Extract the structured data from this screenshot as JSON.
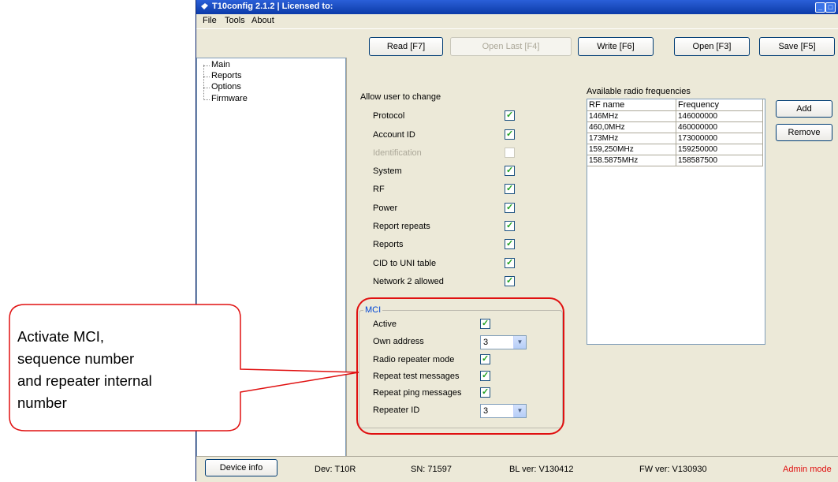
{
  "window": {
    "title": "T10config 2.1.2  |  Licensed to:"
  },
  "menu": {
    "file": "File",
    "tools": "Tools",
    "about": "About"
  },
  "toolbar": {
    "read": "Read [F7]",
    "open_last": "Open Last [F4]",
    "write": "Write [F6]",
    "open": "Open [F3]",
    "save": "Save [F5]"
  },
  "tree": {
    "items": [
      "Main",
      "Reports",
      "Options",
      "Firmware"
    ]
  },
  "allow": {
    "heading": "Allow user to change",
    "items": [
      {
        "label": "Protocol",
        "checked": true,
        "enabled": true
      },
      {
        "label": "Account ID",
        "checked": true,
        "enabled": true
      },
      {
        "label": "Identification",
        "checked": false,
        "enabled": false
      },
      {
        "label": "System",
        "checked": true,
        "enabled": true
      },
      {
        "label": "RF",
        "checked": true,
        "enabled": true
      },
      {
        "label": "Power",
        "checked": true,
        "enabled": true
      },
      {
        "label": "Report repeats",
        "checked": true,
        "enabled": true
      },
      {
        "label": "Reports",
        "checked": true,
        "enabled": true
      },
      {
        "label": "CID to UNI table",
        "checked": true,
        "enabled": true
      },
      {
        "label": "Network 2 allowed",
        "checked": true,
        "enabled": true
      }
    ]
  },
  "frequencies": {
    "heading": "Available radio frequencies",
    "columns": [
      "RF name",
      "Frequency"
    ],
    "rows": [
      [
        "146MHz",
        "146000000"
      ],
      [
        "460,0MHz",
        "460000000"
      ],
      [
        "173MHz",
        "173000000"
      ],
      [
        "159,250MHz",
        "159250000"
      ],
      [
        "158.5875MHz",
        "158587500"
      ]
    ],
    "add": "Add",
    "remove": "Remove"
  },
  "mci": {
    "title": "MCI",
    "active": "Active",
    "own_address": "Own address",
    "own_address_value": "3",
    "radio_repeater_mode": "Radio repeater mode",
    "repeat_test": "Repeat test messages",
    "repeat_ping": "Repeat ping messages",
    "repeater_id": "Repeater ID",
    "repeater_id_value": "3"
  },
  "status": {
    "device_info": "Device info",
    "dev": "Dev:  T10R",
    "sn": "SN:  71597",
    "bl": "BL ver:  V130412",
    "fw": "FW ver:  V130930",
    "mode": "Admin mode"
  },
  "callout": {
    "lines": [
      "Activate MCI,",
      "sequence number",
      "and repeater internal",
      "number"
    ]
  },
  "colors": {
    "highlight": "#e01010",
    "checkmark": "#21a121",
    "admin": "#e01010"
  }
}
